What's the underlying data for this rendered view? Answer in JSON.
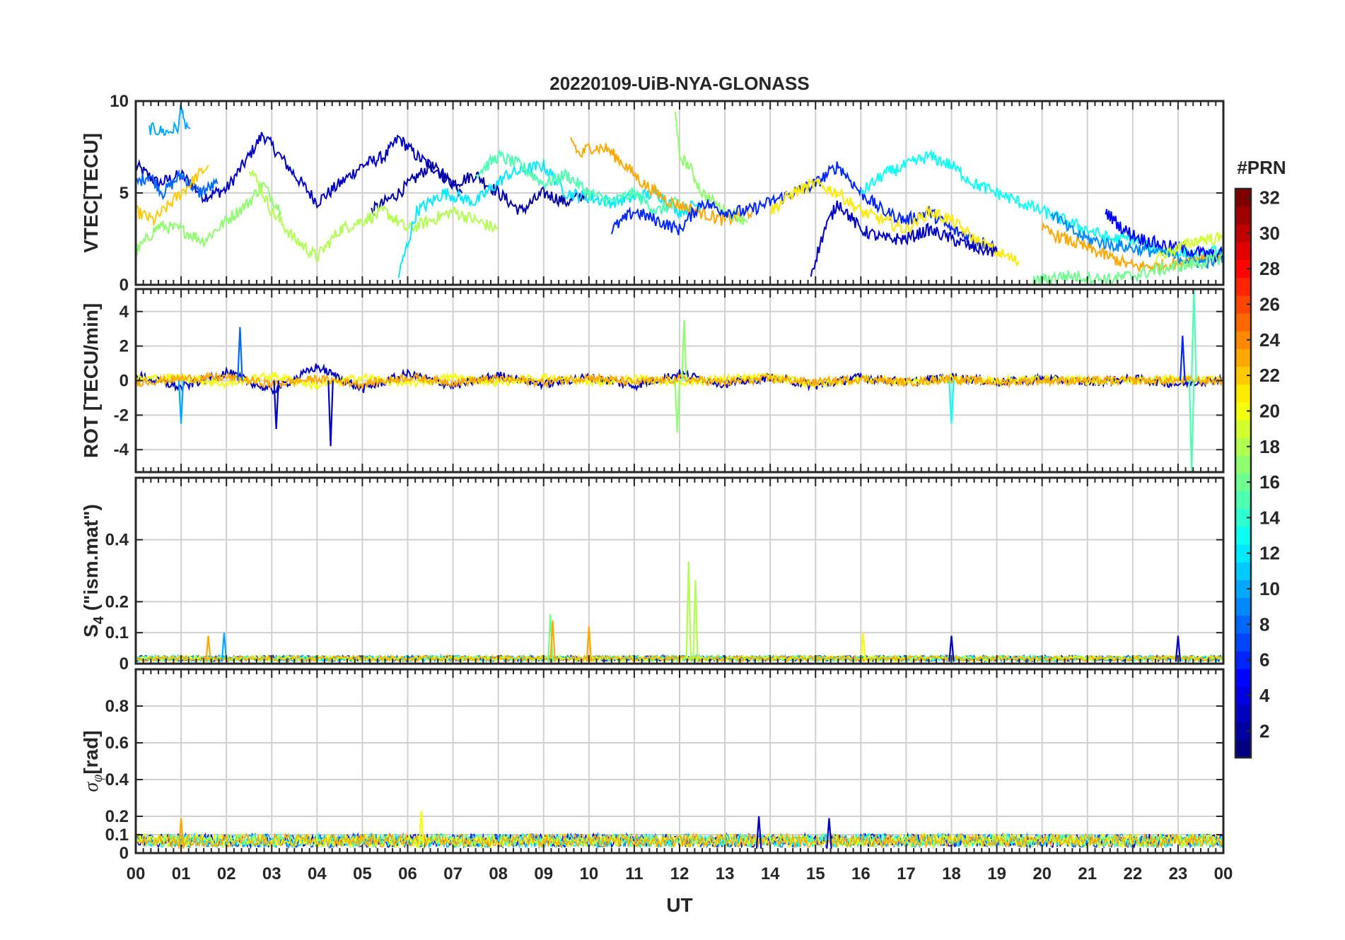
{
  "figure": {
    "title": "20220109-UiB-NYA-GLONASS",
    "xlabel": "UT",
    "x_tick_labels": [
      "00",
      "01",
      "02",
      "03",
      "04",
      "05",
      "06",
      "07",
      "08",
      "09",
      "10",
      "11",
      "12",
      "13",
      "14",
      "15",
      "16",
      "17",
      "18",
      "19",
      "20",
      "21",
      "22",
      "23",
      "00"
    ]
  },
  "colorbar": {
    "label": "#PRN",
    "min": 1,
    "max": 32,
    "colormap": "jet",
    "ticks": [
      2,
      4,
      6,
      8,
      10,
      12,
      14,
      16,
      18,
      20,
      22,
      24,
      26,
      28,
      30,
      32
    ]
  },
  "chart_data": [
    {
      "type": "line",
      "panel": "vtec",
      "ylabel": "VTEC[TECU]",
      "xlim": [
        0,
        24
      ],
      "ylim": [
        0,
        10
      ],
      "yticks": [
        0,
        5,
        10
      ],
      "grid": true,
      "series": [
        {
          "prn": 3,
          "x": [
            0,
            0.5,
            1,
            1.5,
            2,
            2.5,
            2.8,
            3.5,
            4,
            4.5,
            5,
            5.5,
            5.8,
            6.2,
            6.8,
            7.2
          ],
          "y": [
            6.5,
            5.5,
            6,
            4.8,
            5.2,
            7,
            8.2,
            6,
            4.5,
            5.5,
            6.5,
            7,
            8,
            7,
            6,
            5
          ]
        },
        {
          "prn": 2,
          "x": [
            5.2,
            5.8,
            6.5,
            7,
            7.5,
            8,
            8.5,
            9,
            9.5,
            10
          ],
          "y": [
            4,
            5,
            6.5,
            5.5,
            6,
            5,
            4,
            5,
            4.5,
            5
          ]
        },
        {
          "prn": 8,
          "x": [
            0,
            0.3,
            0.6,
            1,
            1.4,
            1.8
          ],
          "y": [
            5.5,
            6,
            5,
            6,
            5,
            5.5
          ]
        },
        {
          "prn": 10,
          "x": [
            0.3,
            0.7,
            0.95,
            1.0,
            1.05,
            1.2
          ],
          "y": [
            8.5,
            8.3,
            8.6,
            10,
            8.8,
            8.5
          ]
        },
        {
          "prn": 22,
          "x": [
            0,
            0.4,
            0.8,
            1.2,
            1.6
          ],
          "y": [
            4,
            3.5,
            4.5,
            5.5,
            6.5
          ]
        },
        {
          "prn": 17,
          "x": [
            0,
            0.5,
            1,
            1.5,
            2,
            2.5,
            2.8,
            3.2
          ],
          "y": [
            1.8,
            3.2,
            3.0,
            2.4,
            3.5,
            4.5,
            5.5,
            4
          ]
        },
        {
          "prn": 18,
          "x": [
            2.5,
            3,
            3.5,
            4,
            4.5,
            5,
            5.5,
            6,
            6.5,
            7,
            7.5,
            8
          ],
          "y": [
            6.5,
            4,
            2.5,
            1.5,
            3,
            3.5,
            4,
            3,
            3.5,
            4,
            3.5,
            3
          ]
        },
        {
          "prn": 12,
          "x": [
            5.8,
            6.2,
            6.8,
            7.5,
            8.2,
            9,
            9.5,
            10.5,
            11.5,
            12,
            12.5
          ],
          "y": [
            0.5,
            4,
            5,
            4.5,
            6,
            6.5,
            5,
            4.5,
            5,
            4,
            4.5
          ]
        },
        {
          "prn": 15,
          "x": [
            7.5,
            8,
            8.5,
            9,
            9.5,
            10,
            10.5,
            11,
            11.5,
            12
          ],
          "y": [
            6,
            7,
            6.5,
            5.5,
            6,
            5,
            4.5,
            5,
            4,
            4.5
          ]
        },
        {
          "prn": 23,
          "x": [
            9.6,
            9.8,
            10,
            10.4,
            10.8,
            11.2,
            11.8,
            12.4,
            13,
            13.6
          ],
          "y": [
            8,
            7,
            7.5,
            7.4,
            6.5,
            5.5,
            4.5,
            4,
            3.5,
            4
          ]
        },
        {
          "prn": 17,
          "x": [
            11.9,
            12.0,
            12.2,
            12.5,
            13,
            13.5
          ],
          "y": [
            9.2,
            7,
            6.5,
            5,
            4,
            3.5
          ]
        },
        {
          "prn": 6,
          "x": [
            10.5,
            11,
            11.5,
            12,
            12.5,
            13,
            13.5,
            14,
            14.5,
            15,
            15.5,
            16,
            16.5,
            17,
            17.5,
            18,
            18.5,
            19
          ],
          "y": [
            3,
            4,
            3.5,
            3,
            4.5,
            4,
            4,
            4.5,
            5,
            5.5,
            6.5,
            5,
            4,
            3.5,
            4,
            3,
            2.5,
            2
          ]
        },
        {
          "prn": 21,
          "x": [
            14,
            14.5,
            15,
            15.5,
            16,
            16.5,
            17,
            17.5,
            18,
            18.5,
            19,
            19.5
          ],
          "y": [
            4,
            5,
            5.5,
            5,
            4,
            3.5,
            3,
            4,
            3.5,
            2.5,
            1.8,
            1.2
          ]
        },
        {
          "prn": 3,
          "x": [
            14.9,
            15.2,
            15.5,
            16,
            16.5,
            17,
            17.5,
            18,
            18.5,
            19
          ],
          "y": [
            0.6,
            3,
            4.5,
            3,
            2.5,
            2.5,
            3,
            2.5,
            2,
            1.8
          ]
        },
        {
          "prn": 13,
          "x": [
            16,
            16.5,
            17,
            17.5,
            18,
            18.5,
            19,
            19.5,
            20,
            20.5,
            21,
            21.5,
            22,
            22.5,
            23,
            23.5,
            24
          ],
          "y": [
            5,
            6,
            6.5,
            7,
            6.5,
            5.5,
            5,
            4.5,
            4,
            3.5,
            3,
            2.5,
            2.5,
            2,
            1.8,
            1.5,
            2
          ]
        },
        {
          "prn": 23,
          "x": [
            20,
            20.5,
            21,
            21.5,
            22,
            22.5,
            23,
            23.5,
            24
          ],
          "y": [
            3,
            2.5,
            2,
            1.5,
            1,
            1,
            1.2,
            1.5,
            1.5
          ]
        },
        {
          "prn": 9,
          "x": [
            20.2,
            20.6,
            21,
            21.5,
            22,
            22.5,
            23,
            23.5,
            24
          ],
          "y": [
            4,
            3,
            2.5,
            2.2,
            2,
            1.8,
            1.5,
            1.2,
            1.4
          ]
        },
        {
          "prn": 5,
          "x": [
            21.4,
            21.8,
            22.2,
            22.6,
            23,
            23.4,
            23.8,
            24
          ],
          "y": [
            4,
            3,
            2.5,
            2.2,
            2,
            1.8,
            1.6,
            1.7
          ]
        },
        {
          "prn": 16,
          "x": [
            19.8,
            20.5,
            21,
            21.5,
            22,
            22.5,
            23,
            23.5,
            24
          ],
          "y": [
            0.2,
            0.5,
            0.4,
            0.3,
            0.5,
            0.8,
            1,
            1.2,
            1.5
          ]
        },
        {
          "prn": 19,
          "x": [
            22.5,
            23,
            23.5,
            24
          ],
          "y": [
            1.5,
            2,
            2.5,
            2.5
          ]
        }
      ]
    },
    {
      "type": "line",
      "panel": "rot",
      "ylabel": "ROT [TECU/min]",
      "xlim": [
        0,
        24
      ],
      "ylim": [
        -5.3,
        5.3
      ],
      "yticks": [
        -4,
        -2,
        0,
        2,
        4
      ],
      "grid": true,
      "series": [
        {
          "prn": 3,
          "x": [
            0,
            1,
            2,
            3,
            4,
            5,
            6,
            7,
            8,
            9,
            10,
            11,
            12,
            13,
            14,
            15,
            16,
            17,
            18,
            19,
            20,
            21,
            22,
            23,
            24
          ],
          "y": [
            0.3,
            -0.4,
            0.5,
            -0.6,
            0.8,
            -0.5,
            0.4,
            -0.3,
            0.3,
            -0.2,
            0.2,
            -0.3,
            0.4,
            -0.2,
            0.2,
            -0.3,
            0.2,
            -0.1,
            0.2,
            -0.1,
            0.1,
            -0.1,
            0.1,
            -0.2,
            0.1
          ]
        },
        {
          "prn": 20,
          "x": [
            0,
            1,
            2,
            3,
            4,
            5,
            6,
            7,
            8,
            9,
            10,
            11,
            12,
            13,
            14,
            15,
            16,
            17,
            18,
            19,
            20,
            21,
            22,
            23,
            24
          ],
          "y": [
            0.1,
            0.2,
            -0.2,
            0.3,
            -0.3,
            0.2,
            -0.2,
            0.2,
            -0.1,
            0.2,
            -0.1,
            0.1,
            -0.1,
            0.1,
            0.2,
            -0.2,
            0.1,
            -0.1,
            0.1,
            0,
            0.1,
            0,
            0,
            0.1,
            0
          ]
        },
        {
          "prn": 23,
          "x": [
            0,
            1,
            2,
            3,
            4,
            5,
            6,
            7,
            8,
            9,
            10,
            11,
            12,
            13,
            14,
            15,
            16,
            17,
            18,
            19,
            20,
            21,
            22,
            23,
            24
          ],
          "y": [
            -0.1,
            0.1,
            0.2,
            -0.2,
            0.1,
            -0.2,
            0.2,
            -0.1,
            0.1,
            -0.1,
            0.2,
            -0.1,
            0.1,
            -0.1,
            0.1,
            -0.1,
            0.1,
            -0.1,
            0.1,
            -0.1,
            0,
            0,
            0,
            0,
            0
          ]
        }
      ],
      "spikes": [
        {
          "prn": 8,
          "x": 2.3,
          "y": 3.1
        },
        {
          "prn": 3,
          "x": 4.3,
          "y": -3.8
        },
        {
          "prn": 3,
          "x": 3.1,
          "y": -2.8
        },
        {
          "prn": 10,
          "x": 1.0,
          "y": -2.5
        },
        {
          "prn": 17,
          "x": 12.1,
          "y": 3.5
        },
        {
          "prn": 17,
          "x": 11.95,
          "y": -3.0
        },
        {
          "prn": 13,
          "x": 18.0,
          "y": -2.5
        },
        {
          "prn": 15,
          "x": 23.35,
          "y": 5.3
        },
        {
          "prn": 15,
          "x": 23.3,
          "y": -5.3
        },
        {
          "prn": 6,
          "x": 23.1,
          "y": 2.6
        }
      ]
    },
    {
      "type": "line",
      "panel": "s4",
      "ylabel": "S4 (\"ism.mat\")",
      "xlim": [
        0,
        24
      ],
      "ylim": [
        0,
        0.6
      ],
      "yticks": [
        0,
        0.1,
        0.2,
        0.4
      ],
      "grid": true,
      "baseline": 0.02,
      "spikes": [
        {
          "prn": 23,
          "x": 1.6,
          "y": 0.09
        },
        {
          "prn": 10,
          "x": 1.95,
          "y": 0.1
        },
        {
          "prn": 16,
          "x": 9.15,
          "y": 0.16
        },
        {
          "prn": 23,
          "x": 9.2,
          "y": 0.14
        },
        {
          "prn": 23,
          "x": 10.0,
          "y": 0.12
        },
        {
          "prn": 18,
          "x": 12.2,
          "y": 0.33
        },
        {
          "prn": 18,
          "x": 12.35,
          "y": 0.27
        },
        {
          "prn": 20,
          "x": 16.05,
          "y": 0.1
        },
        {
          "prn": 3,
          "x": 18.0,
          "y": 0.09
        },
        {
          "prn": 3,
          "x": 23.0,
          "y": 0.09
        }
      ]
    },
    {
      "type": "line",
      "panel": "sigma_phi",
      "ylabel": "σφ[rad]",
      "xlim": [
        0,
        24
      ],
      "ylim": [
        0,
        1
      ],
      "yticks": [
        0,
        0.1,
        0.2,
        0.4,
        0.6,
        0.8
      ],
      "grid": true,
      "baseline": 0.08,
      "spikes": [
        {
          "prn": 20,
          "x": 6.3,
          "y": 0.23
        },
        {
          "prn": 23,
          "x": 1.0,
          "y": 0.19
        },
        {
          "prn": 3,
          "x": 13.75,
          "y": 0.2
        },
        {
          "prn": 3,
          "x": 15.3,
          "y": 0.19
        }
      ]
    }
  ]
}
